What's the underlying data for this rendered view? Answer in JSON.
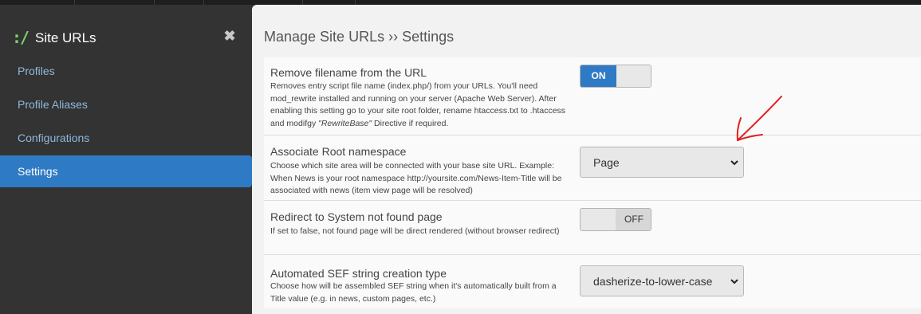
{
  "sidebar": {
    "logo": ":/",
    "title": "Site URLs",
    "close_symbol": "✖",
    "items": [
      {
        "label": "Profiles",
        "active": false
      },
      {
        "label": "Profile Aliases",
        "active": false
      },
      {
        "label": "Configurations",
        "active": false
      },
      {
        "label": "Settings",
        "active": true
      }
    ]
  },
  "main": {
    "title": "Manage Site URLs ›› Settings",
    "settings": [
      {
        "label": "Remove filename from the URL",
        "description": "Removes entry script file name (index.php/) from your URLs. You'll need mod_rewrite installed and running on your server (Apache Web Server). After enabling this setting go to your site root folder, rename htaccess.txt to .htaccess and modifgy ",
        "description_italic": "\"RewriteBase\"",
        "description_tail": " Directive if required.",
        "control": "toggle",
        "state": "ON"
      },
      {
        "label": "Associate Root namespace",
        "description": "Choose which site area will be connected with your base site URL. Example: When News is your root namespace http://yoursite.com/News-Item-Title will be associated with news (item view page will be resolved)",
        "control": "select",
        "value": "Page"
      },
      {
        "label": "Redirect to System not found page",
        "description": "If set to false, not found page will be direct rendered (without browser redirect)",
        "control": "toggle",
        "state": "OFF"
      },
      {
        "label": "Automated SEF string creation type",
        "description": "Choose how will be assembled SEF string when it's automatically built from a Title value (e.g. in news, custom pages, etc.)",
        "control": "select",
        "value": "dasherize-to-lower-case"
      }
    ]
  },
  "icons": {
    "close": "close-icon",
    "dropdown": "chevron-down-icon",
    "annotation": "red-arrow-annotation"
  },
  "colors": {
    "accent": "#2f7ac4",
    "logo": "#7ed36a",
    "annotation": "#e02020"
  }
}
